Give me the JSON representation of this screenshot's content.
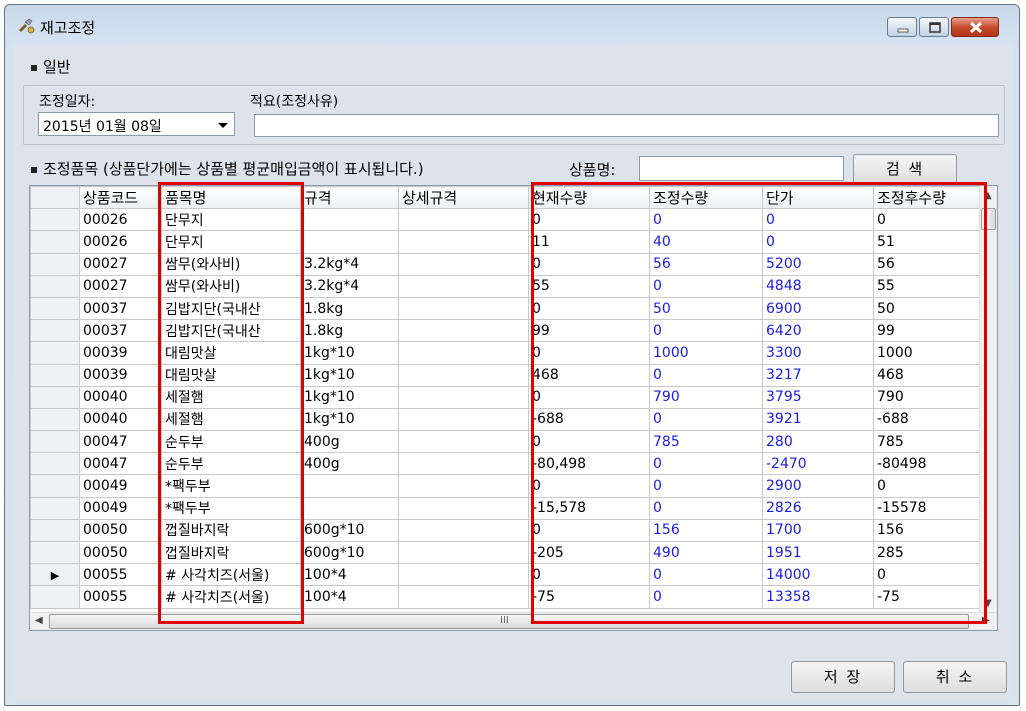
{
  "window": {
    "title": "재고조정",
    "icon": "tools-icon"
  },
  "general": {
    "section_label": "일반",
    "date_label": "조정일자:",
    "date_value": "2015년 01월 08일",
    "memo_label": "적요(조정사유)",
    "memo_value": ""
  },
  "items": {
    "section_label": "조정품목 (상품단가에는 상품별 평균매입금액이 표시됩니다.)",
    "search_label": "상품명:",
    "search_value": "",
    "search_button": "검 색"
  },
  "grid": {
    "columns": [
      "상품코드",
      "품목명",
      "규격",
      "상세규격",
      "현재수량",
      "조정수량",
      "단가",
      "조정후수량"
    ],
    "rows": [
      [
        "00026",
        "단무지",
        "",
        "",
        "0",
        "0",
        "0",
        "0"
      ],
      [
        "00026",
        "단무지",
        "",
        "",
        "11",
        "40",
        "0",
        "51"
      ],
      [
        "00027",
        "쌈무(와사비)",
        "3.2kg*4",
        "",
        "0",
        "56",
        "5200",
        "56"
      ],
      [
        "00027",
        "쌈무(와사비)",
        "3.2kg*4",
        "",
        "55",
        "0",
        "4848",
        "55"
      ],
      [
        "00037",
        "김밥지단(국내산",
        "1.8kg",
        "",
        "0",
        "50",
        "6900",
        "50"
      ],
      [
        "00037",
        "김밥지단(국내산",
        "1.8kg",
        "",
        "99",
        "0",
        "6420",
        "99"
      ],
      [
        "00039",
        "대림맛살",
        "1kg*10",
        "",
        "0",
        "1000",
        "3300",
        "1000"
      ],
      [
        "00039",
        "대림맛살",
        "1kg*10",
        "",
        "468",
        "0",
        "3217",
        "468"
      ],
      [
        "00040",
        "세절햄",
        "1kg*10",
        "",
        "0",
        "790",
        "3795",
        "790"
      ],
      [
        "00040",
        "세절햄",
        "1kg*10",
        "",
        "-688",
        "0",
        "3921",
        "-688"
      ],
      [
        "00047",
        "순두부",
        "400g",
        "",
        "0",
        "785",
        "280",
        "785"
      ],
      [
        "00047",
        "순두부",
        "400g",
        "",
        "-80,498",
        "0",
        "-2470",
        "-80498"
      ],
      [
        "00049",
        "*팩두부",
        "",
        "",
        "0",
        "0",
        "2900",
        "0"
      ],
      [
        "00049",
        "*팩두부",
        "",
        "",
        "-15,578",
        "0",
        "2826",
        "-15578"
      ],
      [
        "00050",
        "껍질바지락",
        "600g*10",
        "",
        "0",
        "156",
        "1700",
        "156"
      ],
      [
        "00050",
        "껍질바지락",
        "600g*10",
        "",
        "-205",
        "490",
        "1951",
        "285"
      ],
      [
        "00055",
        "# 사각치즈(서울)",
        "100*4",
        "",
        "0",
        "0",
        "14000",
        "0"
      ],
      [
        "00055",
        "# 사각치즈(서울)",
        "100*4",
        "",
        "-75",
        "0",
        "13358",
        "-75"
      ]
    ],
    "current_row_index": 16,
    "scroll_hint": "III"
  },
  "footer": {
    "save_button": "저 장",
    "cancel_button": "취 소"
  },
  "colors": {
    "highlight": "#e00000",
    "editable_value": "#1b1be6"
  }
}
